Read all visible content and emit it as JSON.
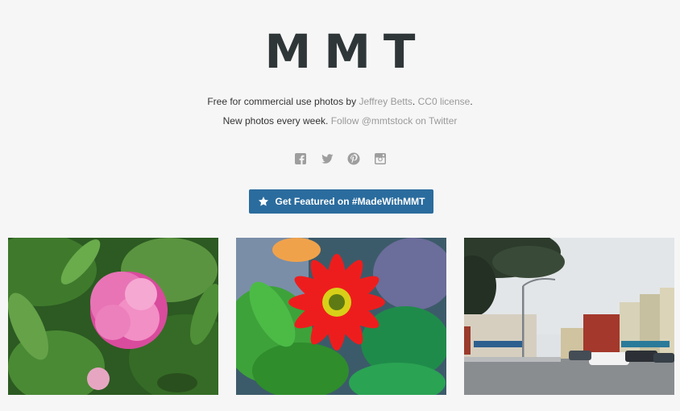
{
  "logo": "MMT",
  "intro": {
    "prefix": "Free for commercial use photos by",
    "author_link": "Jeffrey Betts",
    "license_link": "CC0 license",
    "period": "."
  },
  "weekly": {
    "prefix": "New photos every week.",
    "twitter_link": "Follow @mmtstock on Twitter"
  },
  "social_icons": [
    "facebook-icon",
    "twitter-icon",
    "pinterest-icon",
    "instagram-icon"
  ],
  "cta": {
    "label": "Get Featured on #MadeWithMMT",
    "icon": "star-icon"
  },
  "colors": {
    "background": "#f6f6f6",
    "logo": "#2f3638",
    "link": "#9a9a9a",
    "button": "#2b6c9e"
  }
}
